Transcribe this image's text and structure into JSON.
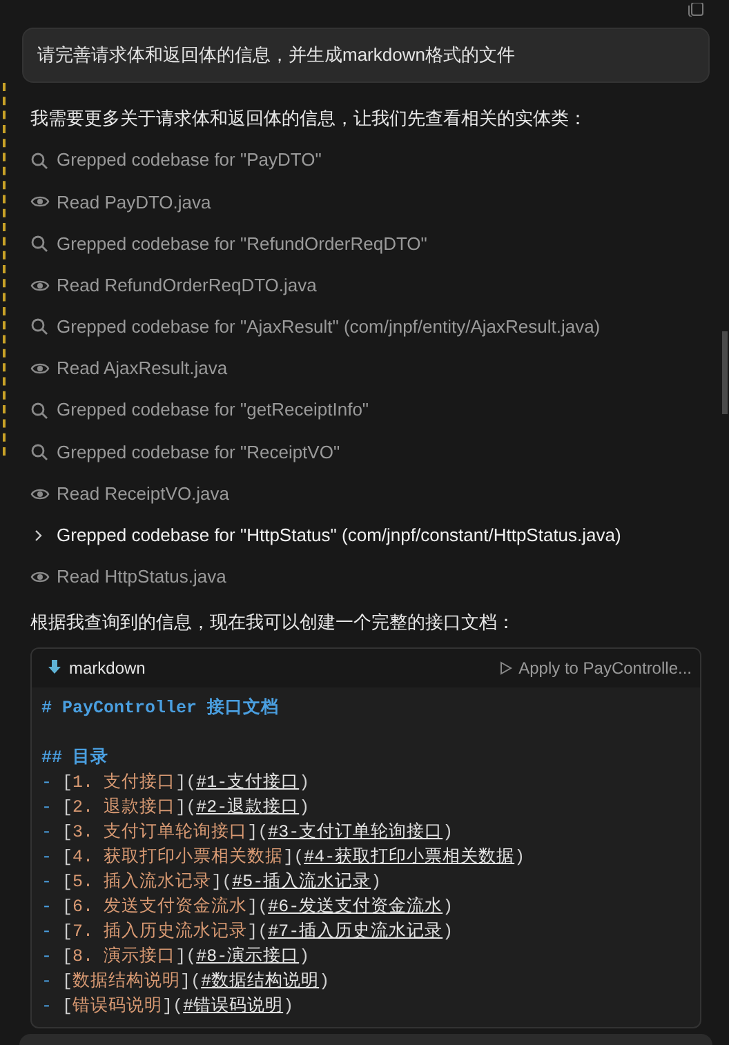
{
  "user_message": "请完善请求体和返回体的信息，并生成markdown格式的文件",
  "intro": "我需要更多关于请求体和返回体的信息，让我们先查看相关的实体类：",
  "steps": [
    {
      "kind": "search",
      "text": "Grepped codebase for \"PayDTO\"",
      "highlighted": false
    },
    {
      "kind": "read",
      "text": "Read PayDTO.java",
      "highlighted": false
    },
    {
      "kind": "search",
      "text": "Grepped codebase for \"RefundOrderReqDTO\"",
      "highlighted": false
    },
    {
      "kind": "read",
      "text": "Read RefundOrderReqDTO.java",
      "highlighted": false
    },
    {
      "kind": "search",
      "text": "Grepped codebase for \"AjaxResult\" (com/jnpf/entity/AjaxResult.java)",
      "highlighted": false
    },
    {
      "kind": "read",
      "text": "Read AjaxResult.java",
      "highlighted": false
    },
    {
      "kind": "search",
      "text": "Grepped codebase for \"getReceiptInfo\"",
      "highlighted": false
    },
    {
      "kind": "search",
      "text": "Grepped codebase for \"ReceiptVO\"",
      "highlighted": false
    },
    {
      "kind": "read",
      "text": "Read ReceiptVO.java",
      "highlighted": false
    },
    {
      "kind": "expandable",
      "text": "Grepped codebase for \"HttpStatus\" (com/jnpf/constant/HttpStatus.java)",
      "highlighted": true
    },
    {
      "kind": "read",
      "text": "Read HttpStatus.java",
      "highlighted": false
    }
  ],
  "summary": "根据我查询到的信息，现在我可以创建一个完整的接口文档：",
  "code_block": {
    "language": "markdown",
    "apply_label": "Apply to PayControlle...",
    "lines": [
      {
        "kind": "h1",
        "marker": "#",
        "text": "PayController 接口文档"
      },
      {
        "kind": "blank"
      },
      {
        "kind": "h2",
        "marker": "##",
        "text": "目录"
      },
      {
        "kind": "link",
        "bullet": "-",
        "open": "[",
        "label": "1. 支付接口",
        "mid": "](",
        "target": "#1-支付接口",
        "close": ")"
      },
      {
        "kind": "link",
        "bullet": "-",
        "open": "[",
        "label": "2. 退款接口",
        "mid": "](",
        "target": "#2-退款接口",
        "close": ")"
      },
      {
        "kind": "link",
        "bullet": "-",
        "open": "[",
        "label": "3. 支付订单轮询接口",
        "mid": "](",
        "target": "#3-支付订单轮询接口",
        "close": ")"
      },
      {
        "kind": "link",
        "bullet": "-",
        "open": "[",
        "label": "4. 获取打印小票相关数据",
        "mid": "](",
        "target": "#4-获取打印小票相关数据",
        "close": ")"
      },
      {
        "kind": "link",
        "bullet": "-",
        "open": "[",
        "label": "5. 插入流水记录",
        "mid": "](",
        "target": "#5-插入流水记录",
        "close": ")"
      },
      {
        "kind": "link",
        "bullet": "-",
        "open": "[",
        "label": "6. 发送支付资金流水",
        "mid": "](",
        "target": "#6-发送支付资金流水",
        "close": ")"
      },
      {
        "kind": "link",
        "bullet": "-",
        "open": "[",
        "label": "7. 插入历史流水记录",
        "mid": "](",
        "target": "#7-插入历史流水记录",
        "close": ")"
      },
      {
        "kind": "link",
        "bullet": "-",
        "open": "[",
        "label": "8. 演示接口",
        "mid": "](",
        "target": "#8-演示接口",
        "close": ")"
      },
      {
        "kind": "link",
        "bullet": "-",
        "open": "[",
        "label": "数据结构说明",
        "mid": "](",
        "target": "#数据结构说明",
        "close": ")"
      },
      {
        "kind": "link",
        "bullet": "-",
        "open": "[",
        "label": "错误码说明",
        "mid": "](",
        "target": "#错误码说明",
        "close": ")"
      }
    ]
  }
}
